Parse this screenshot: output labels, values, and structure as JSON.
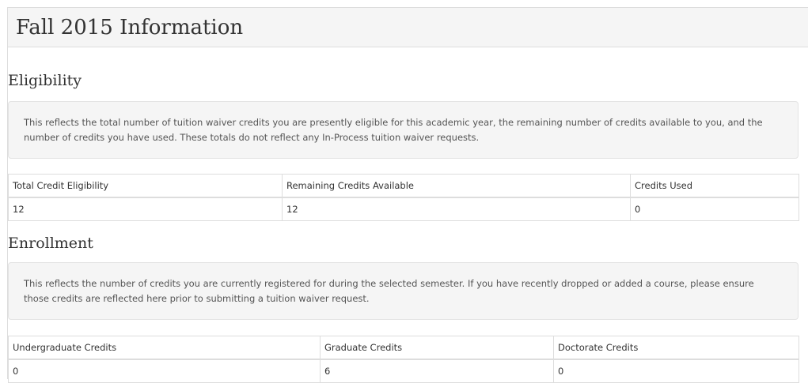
{
  "page": {
    "title": "Fall 2015 Information"
  },
  "eligibility": {
    "heading": "Eligibility",
    "description": "This reflects the total number of tuition waiver credits you are presently eligible for this academic year, the remaining number of credits available to you, and the number of credits you have used. These totals do not reflect any In-Process tuition waiver requests.",
    "columns": [
      "Total Credit Eligibility",
      "Remaining Credits Available",
      "Credits Used"
    ],
    "row": [
      "12",
      "12",
      "0"
    ]
  },
  "enrollment": {
    "heading": "Enrollment",
    "description": "This reflects the number of credits you are currently registered for during the selected semester. If you have recently dropped or added a course, please ensure those credits are reflected here prior to submitting a tuition waiver request.",
    "columns": [
      "Undergraduate Credits",
      "Graduate Credits",
      "Doctorate Credits"
    ],
    "row": [
      "0",
      "6",
      "0"
    ]
  }
}
